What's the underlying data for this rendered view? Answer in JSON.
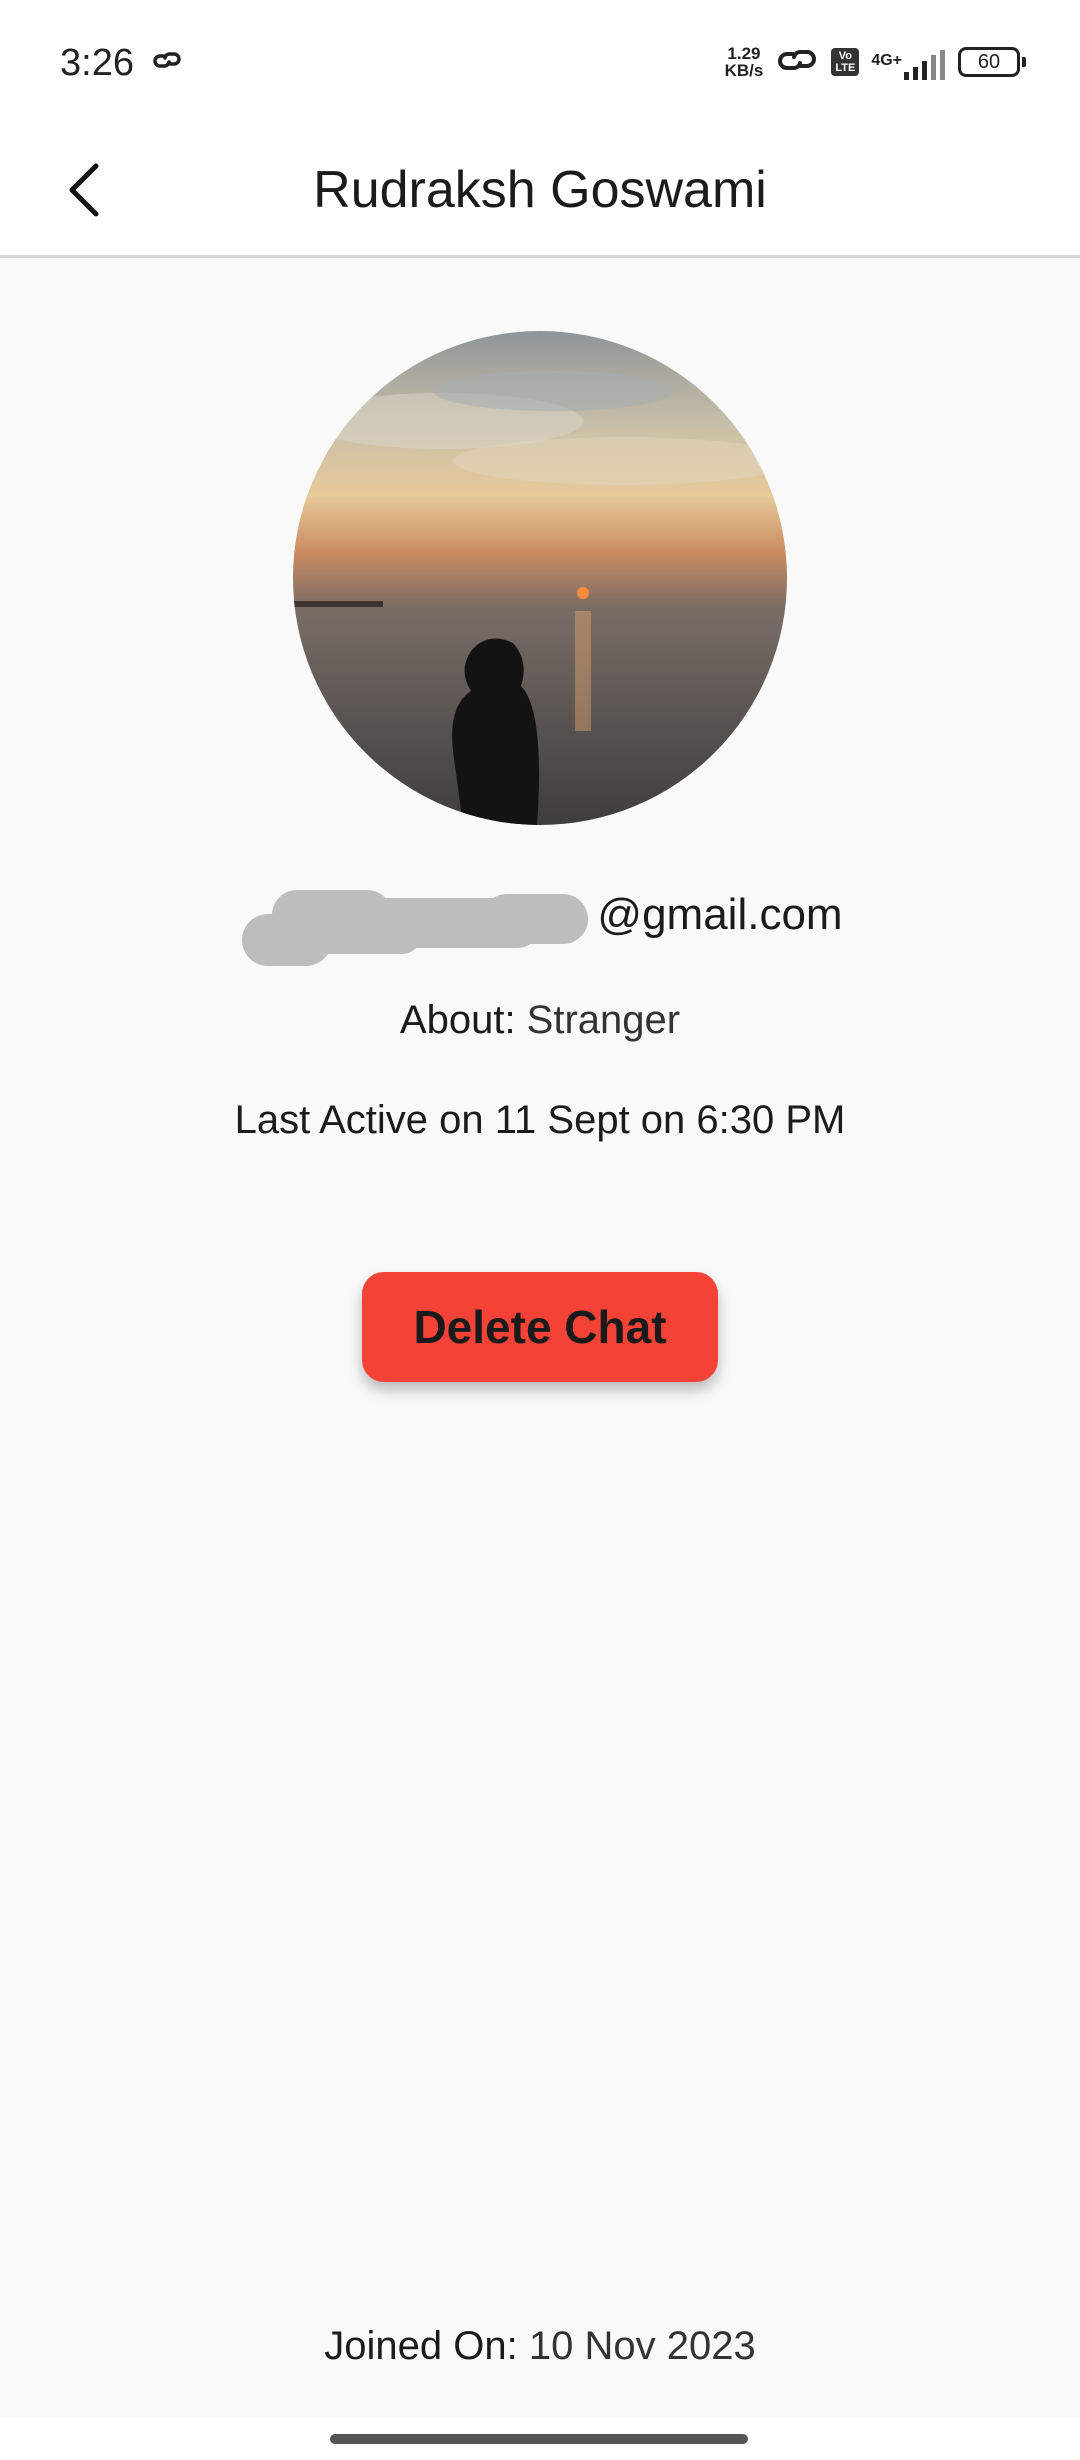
{
  "status_bar": {
    "time": "3:26",
    "net_speed_value": "1.29",
    "net_speed_unit": "KB/s",
    "volte_top": "Vo",
    "volte_bottom": "LTE",
    "network_type": "4G+",
    "battery": "60"
  },
  "app_bar": {
    "title": "Rudraksh Goswami"
  },
  "profile": {
    "email": "@gmail.com",
    "about_label": "About: ",
    "about_value": "Stranger",
    "last_active": "Last Active on 11 Sept on 6:30 PM",
    "delete_label": "Delete Chat",
    "joined_label": "Joined On: ",
    "joined_value": "10 Nov 2023"
  },
  "colors": {
    "delete_button": "#f44336",
    "background": "#f9f9f9",
    "app_bar": "#ffffff"
  }
}
